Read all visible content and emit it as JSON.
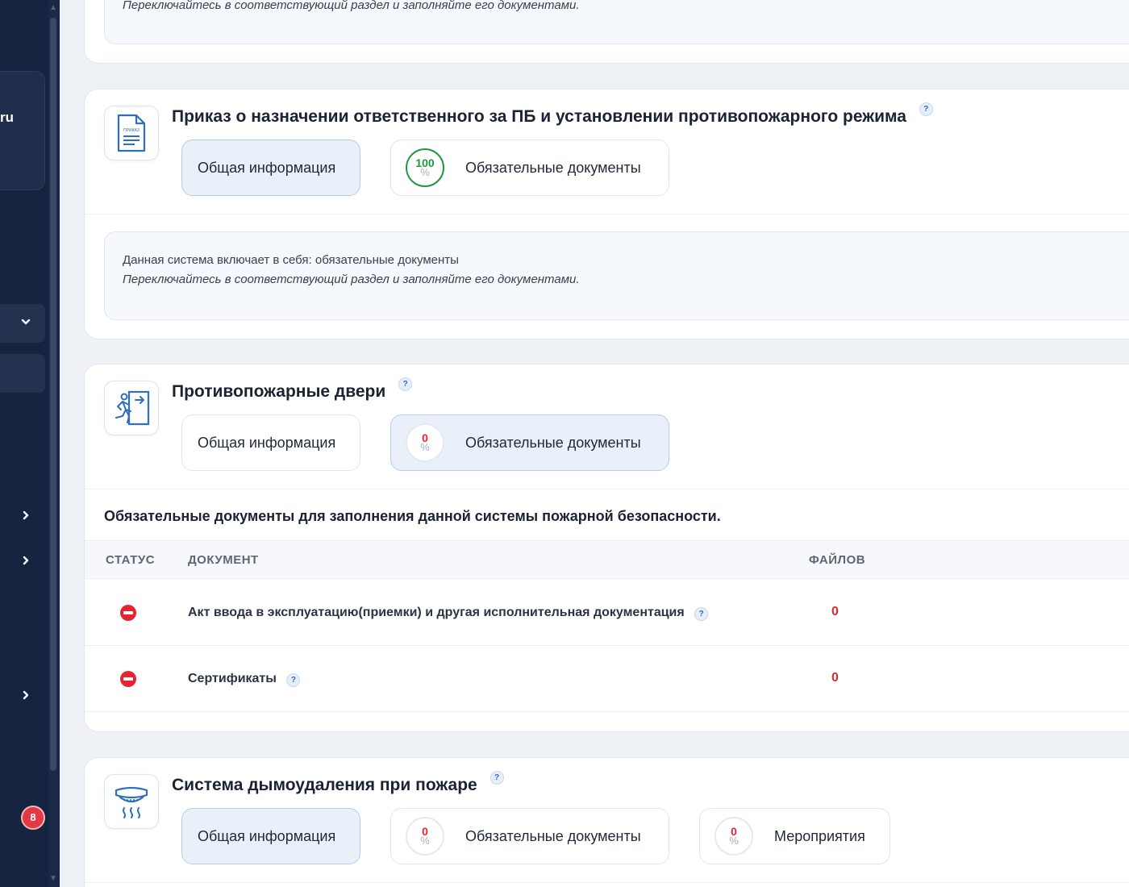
{
  "sidebar": {
    "brand_fragment": "ru",
    "notification_count": "8"
  },
  "common": {
    "tab_general": "Общая информация",
    "tab_required_docs": "Обязательные документы",
    "tab_events": "Мероприятия",
    "help": "?",
    "percent_symbol": "%",
    "info_line1": "Данная система включает в себя: обязательные документы",
    "info_line2": "Переключайтесь в соответствующий раздел и заполняйте его документами."
  },
  "top_card": {
    "info_line2": "Переключайтесь в соответствующий раздел и заполняйте его документами."
  },
  "order_card": {
    "title": "Приказ о назначении ответственного за ПБ и установлении противопожарного режима",
    "icon_caption": "ПРИКАЗ",
    "required_docs_progress": "100",
    "active_tab": "general"
  },
  "doors_card": {
    "title": "Противопожарные двери",
    "required_docs_progress": "0",
    "active_tab": "required_docs",
    "docs_heading": "Обязательные документы для заполнения данной системы пожарной безопасности.",
    "table": {
      "columns": [
        "СТАТУС",
        "ДОКУМЕНТ",
        "ФАЙЛОВ"
      ],
      "rows": [
        {
          "status": "missing",
          "document": "Акт ввода в эксплуатацию(приемки) и другая исполнительная документация",
          "files": "0"
        },
        {
          "status": "missing",
          "document": "Сертификаты",
          "files": "0"
        }
      ]
    }
  },
  "smoke_card": {
    "title": "Система дымоудаления при пожаре",
    "required_docs_progress": "0",
    "events_progress": "0",
    "active_tab": "general"
  },
  "colors": {
    "sidebar_bg": "#162440",
    "active_tab_bg": "#e9f0f9",
    "complete_green": "#1e9a3c",
    "missing_red": "#e5252f",
    "accent_blue": "#2f6dbf"
  }
}
